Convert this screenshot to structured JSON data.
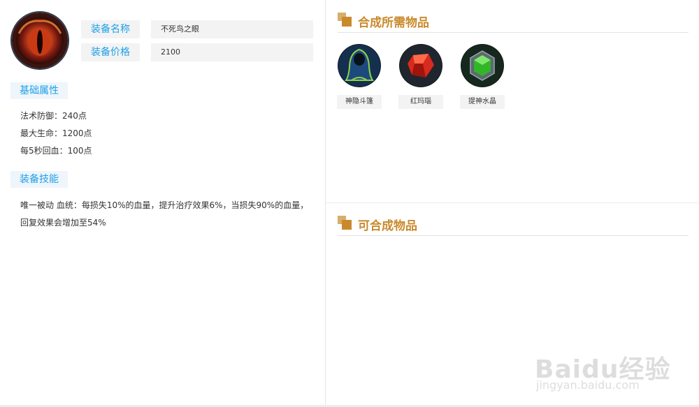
{
  "item": {
    "name_label": "装备名称",
    "name_value": "不死鸟之眼",
    "price_label": "装备价格",
    "price_value": "2100",
    "avatar_icon": "phoenix-eye-icon"
  },
  "basic_attrs": {
    "title": "基础属性",
    "lines": [
      "法术防御：240点",
      "最大生命：1200点",
      "每5秒回血：100点"
    ]
  },
  "skill": {
    "title": "装备技能",
    "lines": [
      "唯一被动 血统：每损失10%的血量，提升治疗效果6%，当损失90%的血量，",
      "回复效果会增加至54%"
    ]
  },
  "components": {
    "title": "合成所需物品",
    "items": [
      {
        "label": "神隐斗篷",
        "icon": "cloak-icon"
      },
      {
        "label": "红玛瑙",
        "icon": "red-gem-icon"
      },
      {
        "label": "提神水晶",
        "icon": "green-crystal-icon"
      }
    ]
  },
  "builds_into": {
    "title": "可合成物品"
  },
  "watermark": {
    "logo": "Baidu经验",
    "url": "jingyan.baidu.com"
  },
  "colors": {
    "accent_blue": "#1ea0e8",
    "accent_gold": "#c98a2c"
  }
}
